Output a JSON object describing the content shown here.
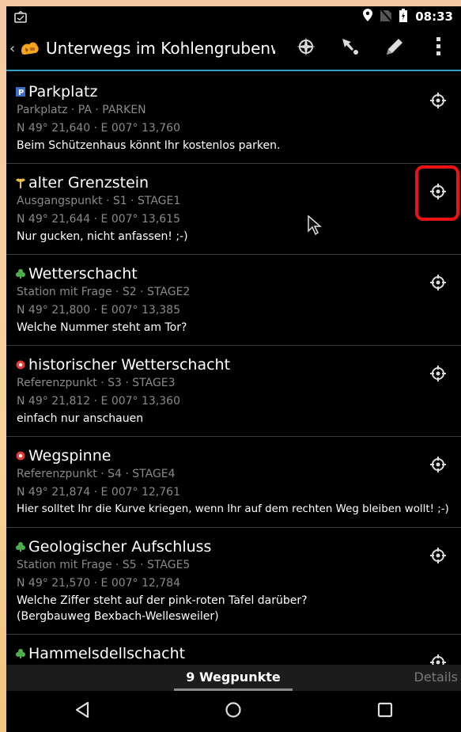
{
  "statusbar": {
    "time": "08:33",
    "icons": [
      "notification-icon",
      "location-icon",
      "no-sim-icon",
      "battery-icon"
    ]
  },
  "actionbar": {
    "title": "Unterwegs im Kohlengrubenw...",
    "buttons": [
      "compass-icon",
      "navigate-icon",
      "edit-icon",
      "overflow-menu-icon"
    ]
  },
  "waypoints": [
    {
      "icon": "parking-icon",
      "name": "Parkplatz",
      "sub": "Parkplatz · PA · PARKEN",
      "coords": "N 49° 21,640 · E 007° 13,760",
      "note": [
        "Beim Schützenhaus könnt Ihr kostenlos parken."
      ]
    },
    {
      "icon": "stage-start-icon",
      "name": "alter Grenzstein",
      "sub": "Ausgangspunkt · S1 · STAGE1",
      "coords": "N 49° 21,644 · E 007° 13,615",
      "note": [
        "Nur gucken, nicht anfassen! ;-)"
      ],
      "highlighted": true
    },
    {
      "icon": "question-station-icon",
      "name": "Wetterschacht",
      "sub": "Station mit Frage · S2 · STAGE2",
      "coords": "N 49° 21,800 · E 007° 13,385",
      "note": [
        "Welche Nummer steht am Tor?"
      ]
    },
    {
      "icon": "reference-point-icon",
      "name": "historischer Wetterschacht",
      "sub": "Referenzpunkt · S3 · STAGE3",
      "coords": "N 49° 21,812 · E 007° 13,360",
      "note": [
        "einfach nur anschauen"
      ]
    },
    {
      "icon": "reference-point-icon",
      "name": "Wegspinne",
      "sub": "Referenzpunkt · S4 · STAGE4",
      "coords": "N 49° 21,874 · E 007° 12,761",
      "note": [
        "Hier solltet Ihr die Kurve kriegen, wenn Ihr auf dem rechten Weg bleiben wollt! ;-)"
      ]
    },
    {
      "icon": "question-station-icon",
      "name": "Geologischer Aufschluss",
      "sub": "Station mit Frage · S5 · STAGE5",
      "coords": "N 49° 21,570 · E 007° 12,784",
      "note": [
        "Welche Ziffer steht auf der pink-roten Tafel darüber?",
        "(Bergbauweg Bexbach-Wellesweiler)"
      ]
    },
    {
      "icon": "question-station-icon",
      "name": "Hammelsdellschacht",
      "sub": "",
      "coords": "",
      "note": []
    }
  ],
  "tabs": {
    "active": "9 Wegpunkte",
    "other": "Details"
  },
  "colors": {
    "accent": "#33a0c8",
    "highlight": "#ee1111",
    "question": "#4caf50",
    "reference": "#e53935",
    "parking": "#3b6ec9",
    "stage_start": "#f0c040"
  }
}
